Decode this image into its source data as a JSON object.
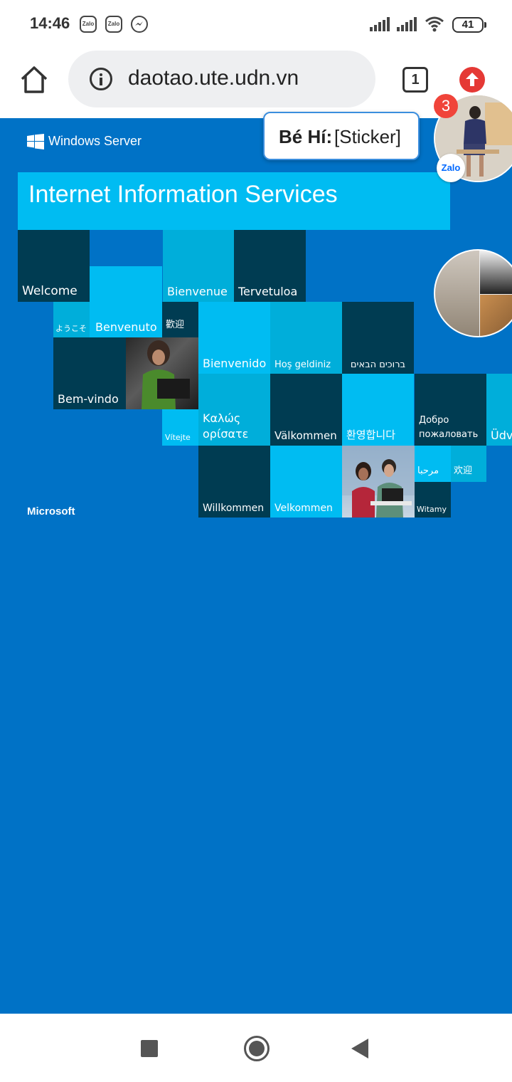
{
  "status_bar": {
    "time": "14:46",
    "notifications": [
      "Zalo",
      "Zalo",
      "messenger-icon"
    ],
    "battery": "41"
  },
  "browser": {
    "url": "daotao.ute.udn.vn",
    "tab_count": "1"
  },
  "page": {
    "brand": "Windows Server",
    "title": "Internet Information Services",
    "footer_brand": "Microsoft",
    "background_color": "#0072c6",
    "tile_colors": [
      "#003c52",
      "#00bcf2",
      "#00aeda"
    ],
    "tiles": {
      "welcome": "Welcome",
      "bienvenue": "Bienvenue",
      "tervetuloa": "Tervetuloa",
      "yokoso": "ようこそ",
      "benvenuto": "Benvenuto",
      "huanying_trad": "歡迎",
      "bienvenido": "Bienvenido",
      "hos_geldiniz": "Hoş geldiniz",
      "hebrew": "ברוכים הבאים",
      "bem_vindo": "Bem-vindo",
      "vitejte": "Vítejte",
      "greek": "Καλώς ορίσατε",
      "valkommen": "Välkommen",
      "korean": "환영합니다",
      "russian": "Добро пожаловать",
      "udv": "Üdv",
      "willkommen": "Willkommen",
      "velkommen": "Velkommen",
      "arabic": "مرحبا",
      "huanying_simp": "欢迎",
      "witamy": "Witamy"
    }
  },
  "zalo_bubble": {
    "sender": "Bé Hí:",
    "message": "[Sticker]",
    "badge_count": "3",
    "app_label": "Zalo"
  }
}
